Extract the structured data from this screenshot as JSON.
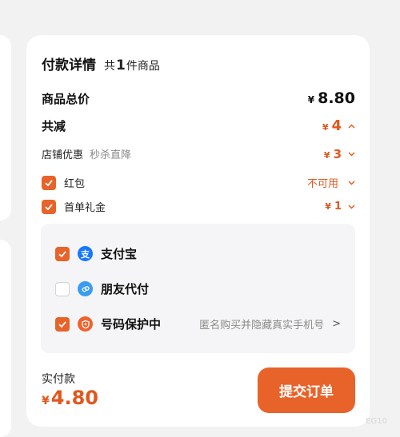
{
  "header": {
    "title": "付款详情",
    "count_prefix": "共",
    "count": "1",
    "count_suffix": "件商品"
  },
  "price_total": {
    "label": "商品总价",
    "currency": "¥",
    "value": "8.80"
  },
  "discount_total": {
    "label": "共减",
    "currency": "¥",
    "value": "4",
    "chevron": "^"
  },
  "store_discount": {
    "label": "店铺优惠",
    "note": "秒杀直降",
    "currency": "¥",
    "value": "3",
    "chevron": "v"
  },
  "red_packet": {
    "label": "红包",
    "value": "不可用",
    "checked": true,
    "chevron": "v"
  },
  "first_order": {
    "label": "首单礼金",
    "currency": "¥",
    "value": "1",
    "checked": true,
    "chevron": "v"
  },
  "payment_options": [
    {
      "label": "支付宝",
      "icon": "alipay-icon",
      "icon_glyph": "支",
      "checked": true
    },
    {
      "label": "朋友代付",
      "icon": "friend-pay-icon",
      "icon_glyph": "",
      "checked": false
    },
    {
      "label": "号码保护中",
      "icon": "number-protect-icon",
      "icon_glyph": "",
      "checked": true,
      "note": "匿名购买并隐藏真实手机号",
      "arrow": ">"
    }
  ],
  "footer": {
    "label": "实付款",
    "currency": "¥",
    "value": "4.80",
    "submit_label": "提交订单"
  },
  "watermark": "EG10",
  "colors": {
    "accent": "#e8632a",
    "accent_text": "#e2571d",
    "alipay_blue": "#1677ff",
    "friend_blue": "#3b9cf2",
    "protect_orange": "#f0622d"
  }
}
